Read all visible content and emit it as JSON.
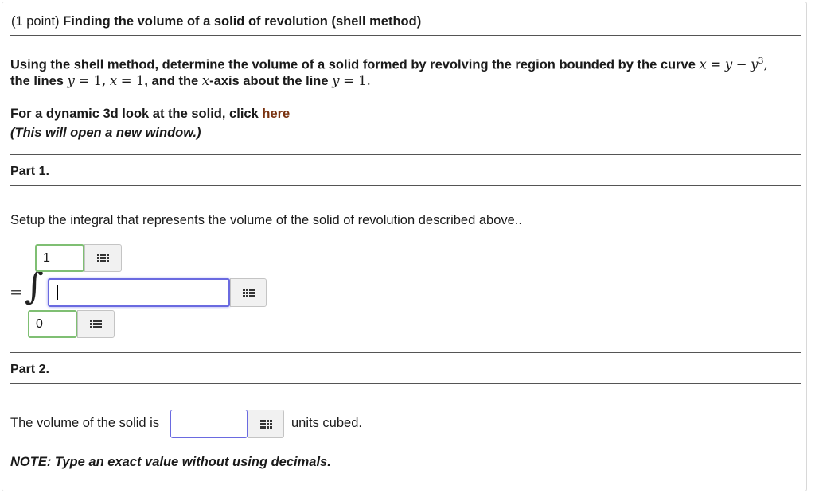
{
  "problem": {
    "points": "(1 point)",
    "title": "Finding the volume of a solid of revolution (shell method)",
    "statement_part1": "Using the shell method, determine the volume of a solid formed by revolving the region bounded by the curve",
    "curve_lhs": "x",
    "curve_eq": "=",
    "curve_rhs_y": "y",
    "curve_minus": "−",
    "curve_rhs_y2": "y",
    "curve_exp": "3",
    "comma1": ",",
    "statement_line2_a": "the lines",
    "line1_var": "y",
    "line1_eq": "= 1",
    "comma2": ",",
    "line2_var": "x",
    "line2_eq": "= 1",
    "statement_line2_b": ", and the",
    "axis_var": "x",
    "statement_line2_c": "-axis about the line",
    "about_var": "y",
    "about_eq": "= 1",
    "period": ".",
    "dynamic_text": "For a dynamic 3d look at the solid, click",
    "dynamic_link": "here",
    "new_window_note": "(This will open a new window.)"
  },
  "part1": {
    "heading": "Part 1.",
    "instruction": "Setup the integral that represents the volume of the solid of revolution described above..",
    "equals": "=",
    "integral_sign": "∫",
    "upper_limit": "1",
    "integrand": "",
    "lower_limit": "0"
  },
  "part2": {
    "heading": "Part 2.",
    "prefix": "The volume of the solid is",
    "answer": "",
    "suffix": "units cubed.",
    "note": "NOTE: Type an exact value without using decimals."
  },
  "icons": {
    "palette": "equation-palette-icon"
  }
}
